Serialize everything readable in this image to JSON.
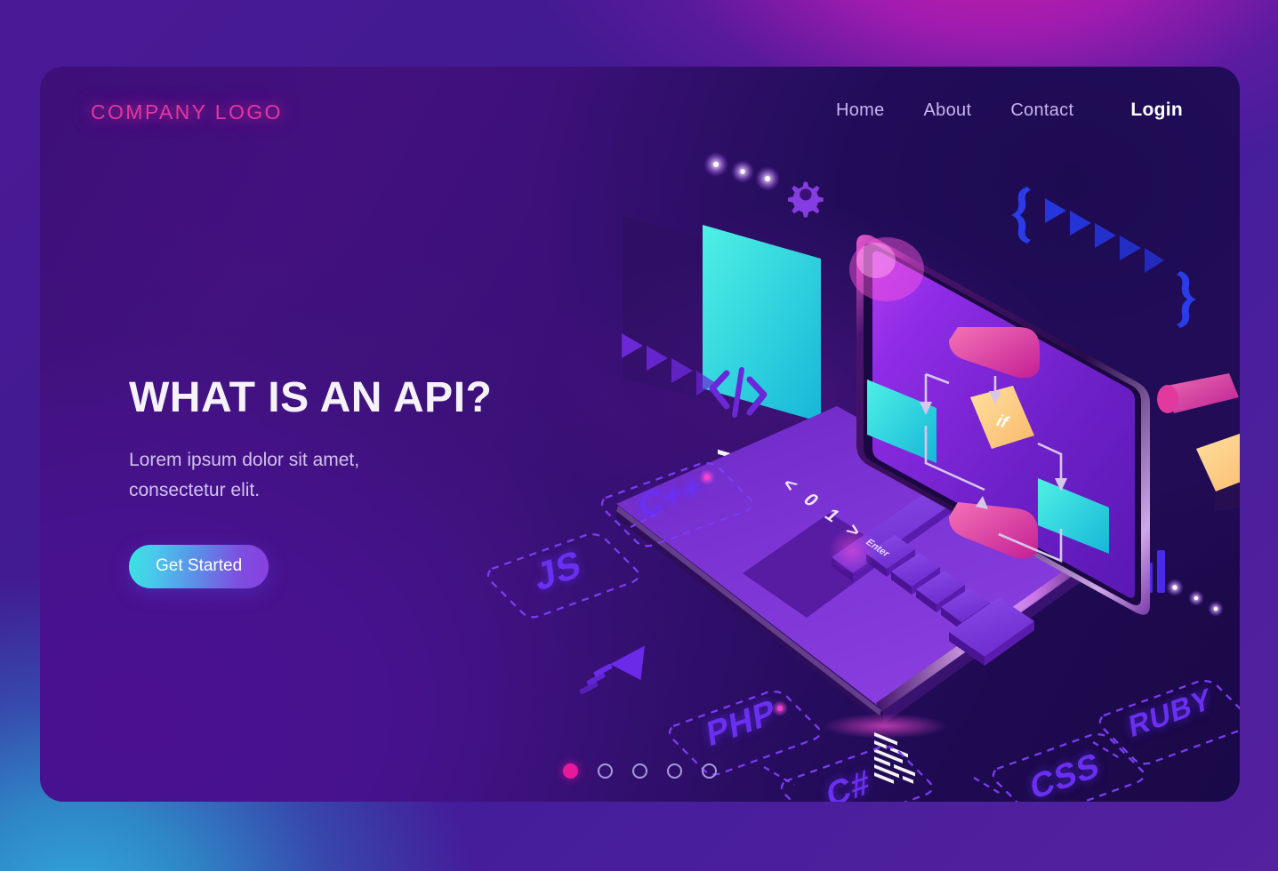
{
  "header": {
    "logo": "COMPANY LOGO",
    "nav": [
      {
        "label": "Home"
      },
      {
        "label": "About"
      },
      {
        "label": "Contact"
      },
      {
        "label": "Login"
      }
    ]
  },
  "hero": {
    "title": "WHAT IS AN API?",
    "subtitle": "Lorem ipsum dolor sit amet, consectetur elit.",
    "cta_label": "Get Started"
  },
  "carousel": {
    "total": 5,
    "active_index": 0,
    "active_color": "#e8189c",
    "idle_color": "#a79adc"
  },
  "illustration": {
    "language_tags": [
      {
        "label": "C++"
      },
      {
        "label": "JS"
      },
      {
        "label": "PHP"
      },
      {
        "label": "C#"
      },
      {
        "label": "CSS"
      },
      {
        "label": "RUBY"
      }
    ],
    "keyboard_keys": [
      "<",
      "0",
      "1",
      ">"
    ],
    "enter_key_label": "Enter",
    "flowchart": {
      "decision_label": "if",
      "nodes": [
        "pill-start",
        "code-block",
        "if-decision",
        "cyan-output",
        "pill-end"
      ]
    },
    "code_symbol": "</>",
    "brace_open": "{",
    "brace_close": "}",
    "icons": [
      "gear-icon",
      "arrow-icon",
      "bar-chart-icon",
      "code-tag-icon"
    ]
  },
  "colors": {
    "accent_pink": "#e8189c",
    "accent_cyan": "#2ad4e0",
    "accent_violet": "#6a2ff0",
    "card_bg": "#3d0f78",
    "page_bg": "#3d1a8a"
  }
}
